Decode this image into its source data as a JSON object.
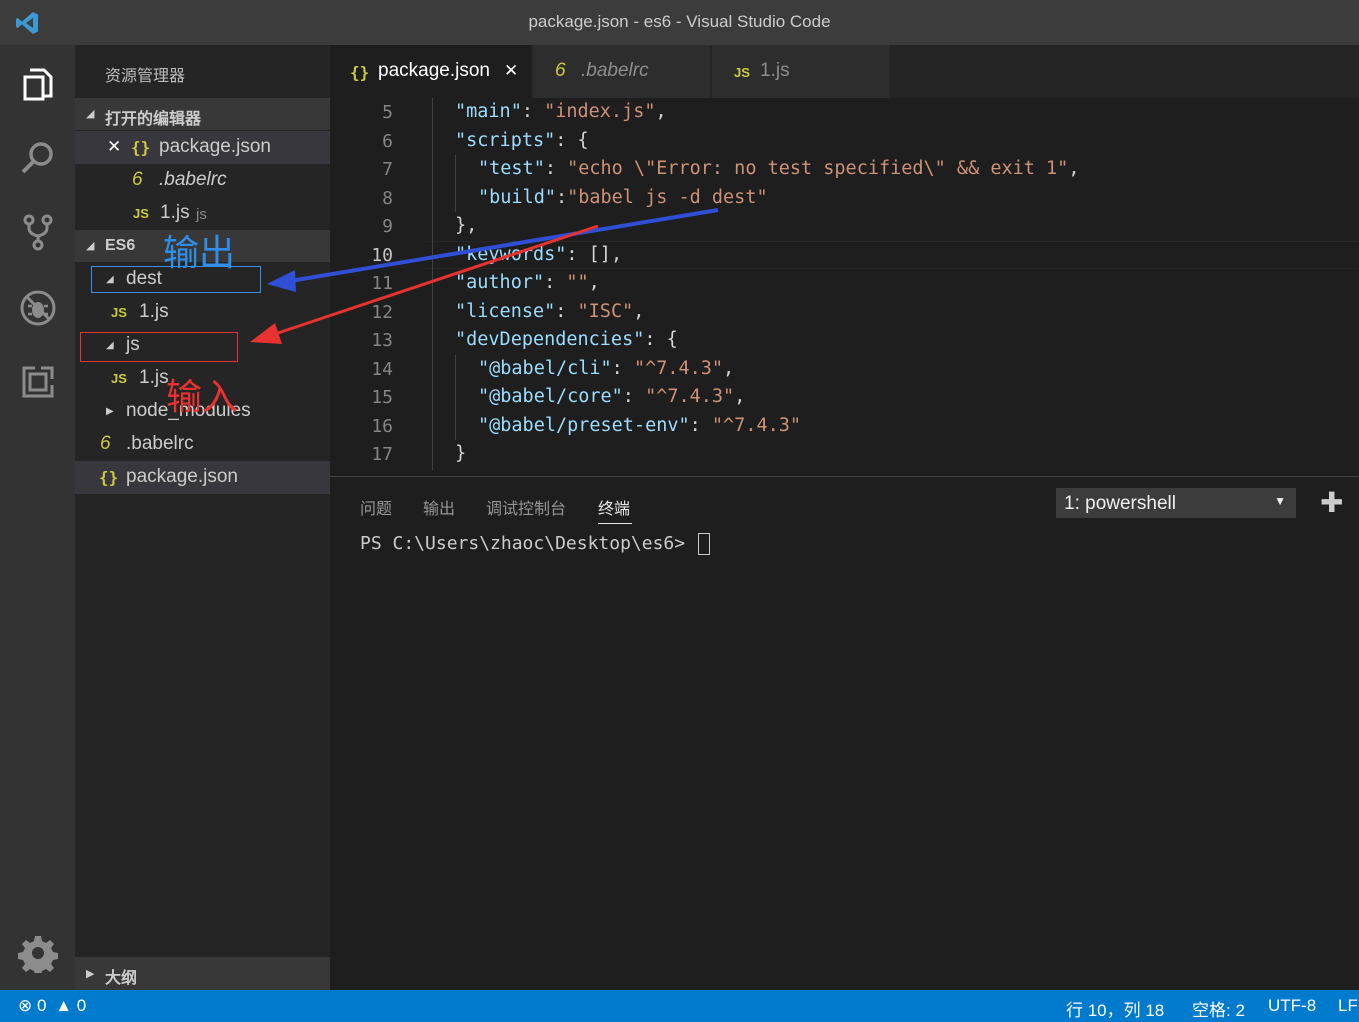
{
  "window": {
    "title": "package.json - es6 - Visual Studio Code"
  },
  "activity": [
    "explorer-icon",
    "search-icon",
    "source-control-icon",
    "debug-icon",
    "extensions-icon",
    "settings-icon"
  ],
  "sidebar": {
    "header": "资源管理器",
    "open_editors": {
      "title": "打开的编辑器",
      "items": [
        {
          "close": "✕",
          "icon": "{}",
          "name": "package.json"
        },
        {
          "icon": "6",
          "name": ".babelrc"
        },
        {
          "icon": "JS",
          "name": "1.js",
          "desc": "js"
        }
      ]
    },
    "project": {
      "title": "ES6",
      "tree": [
        {
          "name": "dest",
          "twisty": "◢"
        },
        {
          "icon": "JS",
          "name": "1.js"
        },
        {
          "name": "js",
          "twisty": "◢"
        },
        {
          "icon": "JS",
          "name": "1.js"
        },
        {
          "name": "node_modules",
          "twisty": "▶"
        },
        {
          "icon": "6",
          "name": ".babelrc"
        },
        {
          "icon": "{}",
          "name": "package.json"
        }
      ]
    },
    "outline": {
      "title": "大纲"
    }
  },
  "annotations": {
    "output": "输出",
    "input": "输入",
    "output_color": "#2f6fd6",
    "input_color": "#e8322f"
  },
  "tabs": [
    {
      "icon": "{}",
      "label": "package.json",
      "close": "✕"
    },
    {
      "icon": "6",
      "label": ".babelrc"
    },
    {
      "icon": "JS",
      "label": "1.js"
    }
  ],
  "editor": {
    "line_numbers": [
      "5",
      "6",
      "7",
      "8",
      "9",
      "10",
      "11",
      "12",
      "13",
      "14",
      "15",
      "16",
      "17"
    ],
    "current_line": "10",
    "lines": [
      {
        "key": "\"main\"",
        "sep": ": ",
        "val": "\"index.js\"",
        "tail": ","
      },
      {
        "key": "\"scripts\"",
        "sep": ": ",
        "val": "",
        "tail": "{"
      },
      {
        "key": "\"test\"",
        "sep": ": ",
        "val": "\"echo \\\"Error: no test specified\\\" && exit 1\"",
        "tail": ","
      },
      {
        "key": "\"build\"",
        "sep": ":",
        "val": "\"babel js -d dest\"",
        "tail": ""
      },
      {
        "key": "",
        "sep": "",
        "val": "",
        "tail": "},"
      },
      {
        "key": "\"keywords\"",
        "sep": ": ",
        "val": "",
        "tail": "[],"
      },
      {
        "key": "\"author\"",
        "sep": ": ",
        "val": "\"\"",
        "tail": ","
      },
      {
        "key": "\"license\"",
        "sep": ": ",
        "val": "\"ISC\"",
        "tail": ","
      },
      {
        "key": "\"devDependencies\"",
        "sep": ": ",
        "val": "",
        "tail": "{"
      },
      {
        "key": "\"@babel/cli\"",
        "sep": ": ",
        "val": "\"^7.4.3\"",
        "tail": ","
      },
      {
        "key": "\"@babel/core\"",
        "sep": ": ",
        "val": "\"^7.4.3\"",
        "tail": ","
      },
      {
        "key": "\"@babel/preset-env\"",
        "sep": ": ",
        "val": "\"^7.4.3\"",
        "tail": ""
      },
      {
        "key": "",
        "sep": "",
        "val": "",
        "tail": "}"
      }
    ]
  },
  "panel": {
    "tabs": [
      "问题",
      "输出",
      "调试控制台",
      "终端"
    ],
    "active_tab": "终端",
    "terminal_select": "1: powershell",
    "select_arrow": "▼",
    "add": "✚",
    "prompt": "PS C:\\Users\\zhaoc\\Desktop\\es6> "
  },
  "status": {
    "errors": "0",
    "warnings": "0",
    "position": "行 10，列 18",
    "spaces": "空格: 2",
    "encoding": "UTF-8",
    "eol": "LF"
  }
}
